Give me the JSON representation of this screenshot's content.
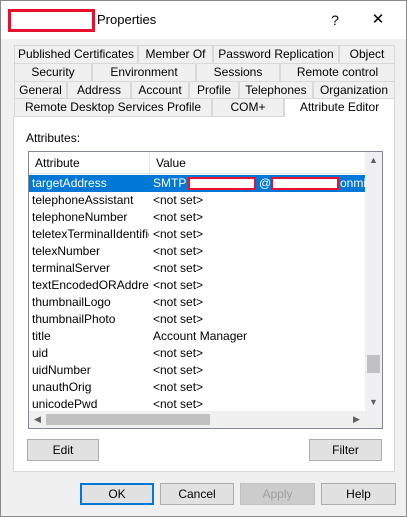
{
  "window": {
    "title": "Properties",
    "help_glyph": "?",
    "close_glyph": "✕"
  },
  "tabs": {
    "row1": [
      "Published Certificates",
      "Member Of",
      "Password Replication",
      "Object"
    ],
    "row2": [
      "Security",
      "Environment",
      "Sessions",
      "Remote control"
    ],
    "row3": [
      "General",
      "Address",
      "Account",
      "Profile",
      "Telephones",
      "Organization"
    ],
    "row4": [
      "Remote Desktop Services Profile",
      "COM+",
      "Attribute Editor"
    ],
    "active": "Attribute Editor"
  },
  "attributes": {
    "label": "Attributes:",
    "columns": [
      "Attribute",
      "Value"
    ],
    "rows": [
      {
        "name": "targetAddress",
        "value": "SMTP",
        "value_suffix": "@",
        "value_tail": "onmic",
        "selected": true
      },
      {
        "name": "telephoneAssistant",
        "value": "<not set>"
      },
      {
        "name": "telephoneNumber",
        "value": "<not set>"
      },
      {
        "name": "teletexTerminalIdentifier",
        "value": "<not set>"
      },
      {
        "name": "telexNumber",
        "value": "<not set>"
      },
      {
        "name": "terminalServer",
        "value": "<not set>"
      },
      {
        "name": "textEncodedORAddress",
        "value": "<not set>"
      },
      {
        "name": "thumbnailLogo",
        "value": "<not set>"
      },
      {
        "name": "thumbnailPhoto",
        "value": "<not set>"
      },
      {
        "name": "title",
        "value": "Account Manager"
      },
      {
        "name": "uid",
        "value": "<not set>"
      },
      {
        "name": "uidNumber",
        "value": "<not set>"
      },
      {
        "name": "unauthOrig",
        "value": "<not set>"
      },
      {
        "name": "unicodePwd",
        "value": "<not set>"
      }
    ],
    "scroll_up": "▲",
    "scroll_down": "▼",
    "scroll_left": "◀",
    "scroll_right": "▶"
  },
  "panel_buttons": {
    "edit": "Edit",
    "filter": "Filter"
  },
  "dialog_buttons": {
    "ok": "OK",
    "cancel": "Cancel",
    "apply": "Apply",
    "help": "Help"
  },
  "colors": {
    "selection": "#0078d7",
    "redaction": "#e8112d"
  }
}
